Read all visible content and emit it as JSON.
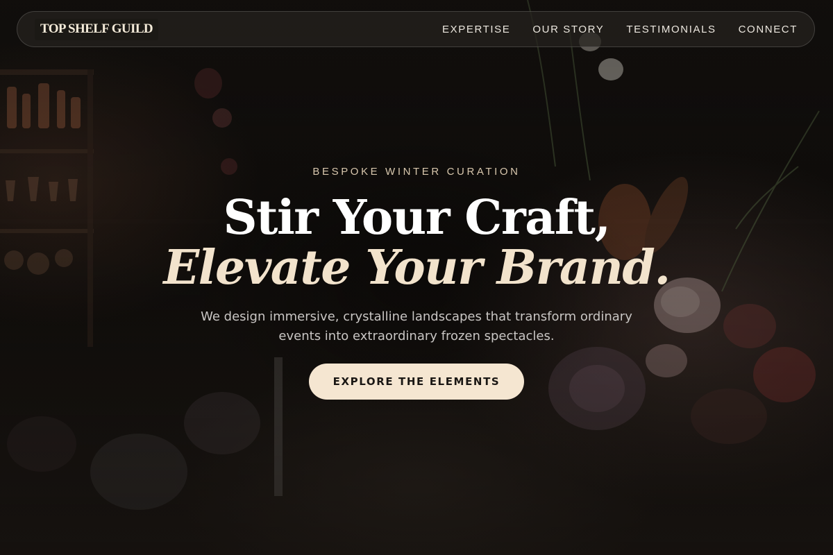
{
  "brand": {
    "logo_text": "TOP SHELF GUILD",
    "accent_color": "#f5e6d1",
    "heading_accent_color": "#f2e3cc"
  },
  "nav": {
    "links": [
      {
        "label": "EXPERTISE"
      },
      {
        "label": "OUR STORY"
      },
      {
        "label": "TESTIMONIALS"
      },
      {
        "label": "CONNECT"
      }
    ]
  },
  "hero": {
    "eyebrow": "BESPOKE WINTER CURATION",
    "title_line_1": "Stir Your Craft,",
    "title_line_2": "Elevate Your Brand.",
    "subtitle": "We design immersive, crystalline landscapes that transform ordinary events into extraordinary frozen spectacles.",
    "cta_label": "EXPLORE THE ELEMENTS"
  }
}
